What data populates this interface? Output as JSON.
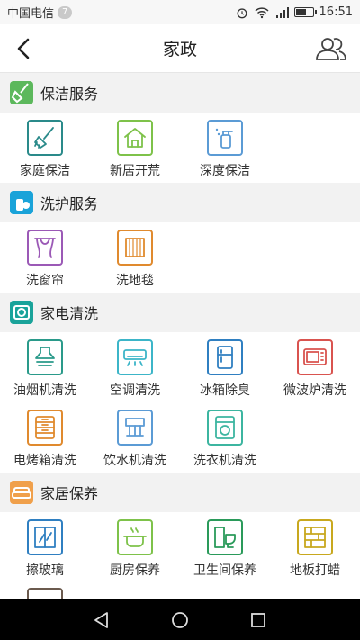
{
  "status_bar": {
    "carrier": "中国电信",
    "badge": "7",
    "time": "16:51",
    "battery_level": 0.7
  },
  "navbar": {
    "title": "家政",
    "back_icon": "chevron-left-icon",
    "right_icon": "people-icon"
  },
  "sections": [
    {
      "title": "保洁服务",
      "icon": "broom-icon",
      "color": "#5cb85c",
      "items": [
        {
          "label": "家庭保洁",
          "icon": "broom-icon",
          "color": "#2a8a8a"
        },
        {
          "label": "新居开荒",
          "icon": "house-icon",
          "color": "#7ec24a"
        },
        {
          "label": "深度保洁",
          "icon": "spray-bottle-icon",
          "color": "#5b9bd5"
        }
      ]
    },
    {
      "title": "洗护服务",
      "icon": "detergent-icon",
      "color": "#1aa3d9",
      "items": [
        {
          "label": "洗窗帘",
          "icon": "curtain-icon",
          "color": "#9b59b6"
        },
        {
          "label": "洗地毯",
          "icon": "carpet-icon",
          "color": "#e08a2e"
        }
      ]
    },
    {
      "title": "家电清洗",
      "icon": "appliance-icon",
      "color": "#1aa39a",
      "items": [
        {
          "label": "油烟机清洗",
          "icon": "range-hood-icon",
          "color": "#2a9a8a"
        },
        {
          "label": "空调清洗",
          "icon": "air-conditioner-icon",
          "color": "#3cb5c8"
        },
        {
          "label": "冰箱除臭",
          "icon": "refrigerator-icon",
          "color": "#2f7fc1"
        },
        {
          "label": "微波炉清洗",
          "icon": "microwave-icon",
          "color": "#d9534f"
        },
        {
          "label": "电烤箱清洗",
          "icon": "oven-icon",
          "color": "#e08a2e"
        },
        {
          "label": "饮水机清洗",
          "icon": "water-dispenser-icon",
          "color": "#5b9bd5"
        },
        {
          "label": "洗衣机清洗",
          "icon": "washing-machine-icon",
          "color": "#3cb5a0"
        }
      ]
    },
    {
      "title": "家居保养",
      "icon": "sofa-icon",
      "color": "#f0a04b",
      "items": [
        {
          "label": "擦玻璃",
          "icon": "window-icon",
          "color": "#2f7fc1"
        },
        {
          "label": "厨房保养",
          "icon": "cooking-pot-icon",
          "color": "#7ec24a"
        },
        {
          "label": "卫生间保养",
          "icon": "toilet-icon",
          "color": "#2a9a5a"
        },
        {
          "label": "地板打蜡",
          "icon": "floor-tiles-icon",
          "color": "#c8a81e"
        }
      ]
    }
  ],
  "system_nav": {
    "back_icon": "triangle-back-icon",
    "home_icon": "circle-home-icon",
    "recents_icon": "square-recents-icon"
  }
}
